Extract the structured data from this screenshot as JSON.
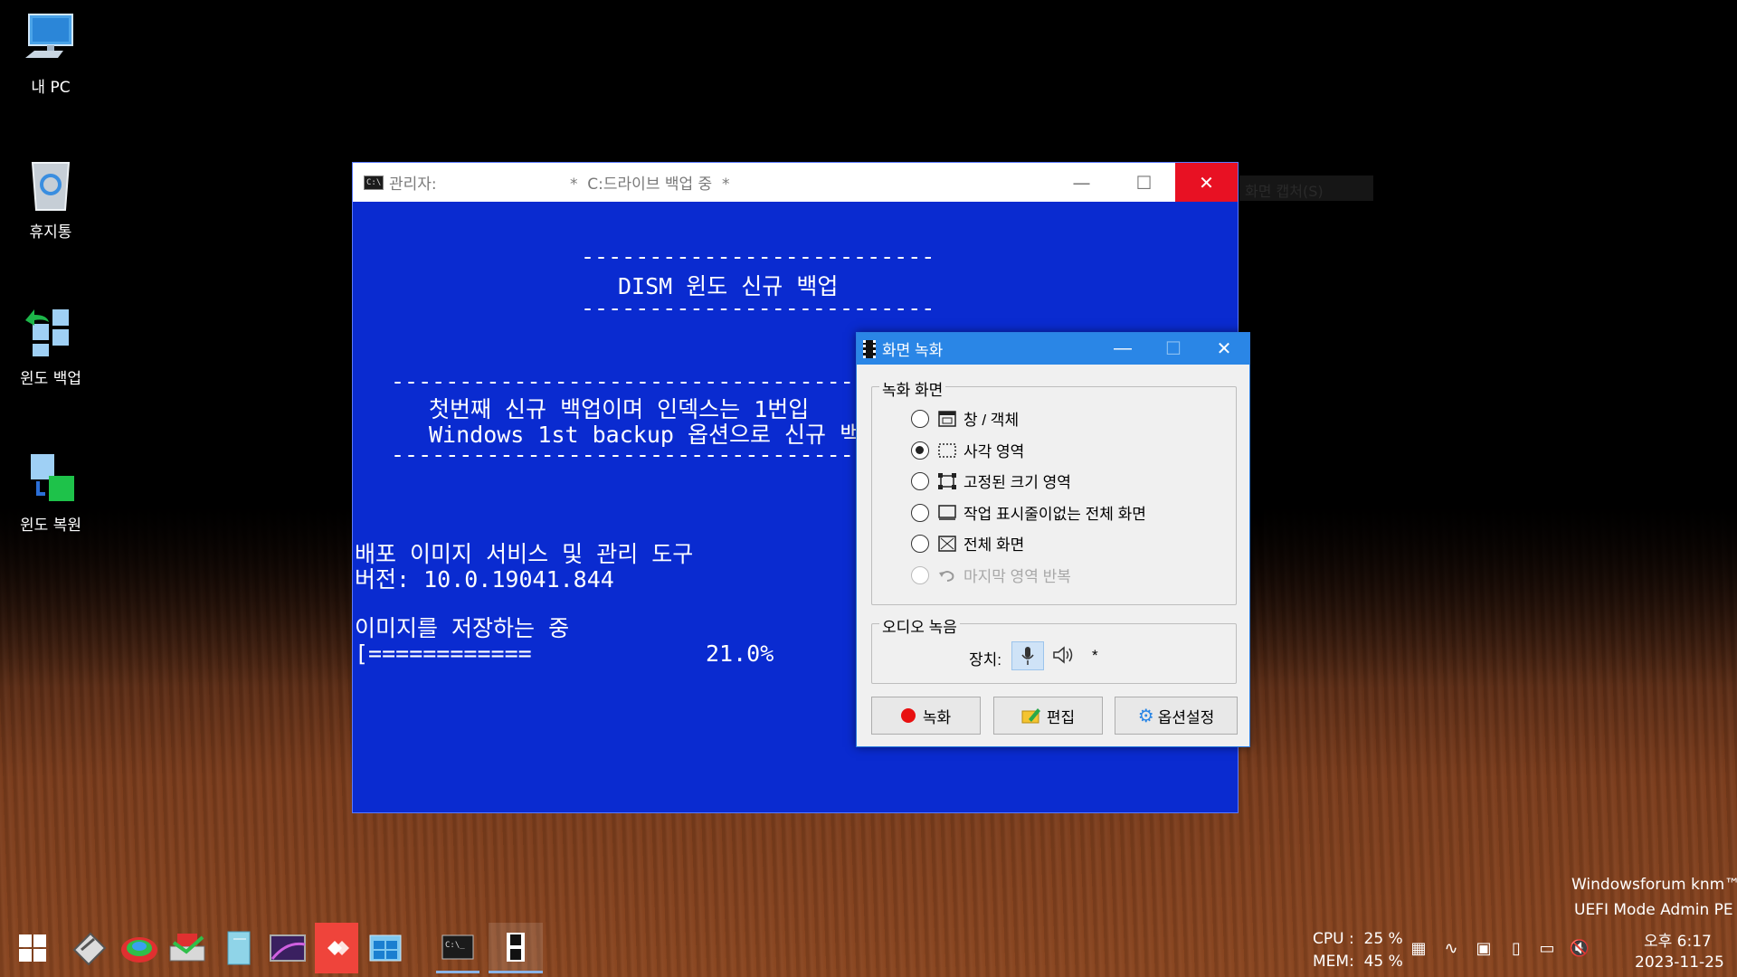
{
  "desktop": {
    "icons": [
      {
        "label": "내 PC",
        "icon": "monitor-icon"
      },
      {
        "label": "휴지통",
        "icon": "recycle-bin-icon"
      },
      {
        "label": "윈도 백업",
        "icon": "windows-backup-icon"
      },
      {
        "label": "윈도 복원",
        "icon": "windows-restore-icon"
      }
    ],
    "watermark": {
      "line1": "Windowsforum knm™",
      "line2": "UEFI Mode Admin PE"
    }
  },
  "console": {
    "title_prefix": "관리자:",
    "title_main": "*  C:드라이브 백업 중  *",
    "minimize": "—",
    "maximize": "☐",
    "close": "✕",
    "lines": {
      "rule1": "--------------------------",
      "heading": "DISM 윈도 신규 백업",
      "rule2": "--------------------------",
      "rule3": "------------------------------------------",
      "info1": "첫번째 신규 백업이며 인덱스는 1번입",
      "info2": "Windows 1st backup 옵션으로 신규 백",
      "rule4": "------------------------------------------",
      "tool_name": "배포 이미지 서비스 및 관리 도구",
      "version": "버전: 10.0.19041.844",
      "saving": "이미지를 저장하는 중",
      "progress_bar": "[============",
      "progress_pct": "21.0%"
    },
    "progress": 21.0
  },
  "capture_hint": "화면 캡처(S)",
  "recorder": {
    "title": "화면 녹화",
    "minimize": "—",
    "maximize": "☐",
    "close": "✕",
    "record_screen_group": "녹화 화면",
    "options": [
      {
        "label": "창 / 객체",
        "checked": false,
        "enabled": true,
        "icon": "window-object-icon"
      },
      {
        "label": "사각 영역",
        "checked": true,
        "enabled": true,
        "icon": "rectangle-area-icon"
      },
      {
        "label": "고정된 크기 영역",
        "checked": false,
        "enabled": true,
        "icon": "fixed-size-area-icon"
      },
      {
        "label": "작업 표시줄이없는 전체 화면",
        "checked": false,
        "enabled": true,
        "icon": "fullscreen-no-taskbar-icon"
      },
      {
        "label": "전체 화면",
        "checked": false,
        "enabled": true,
        "icon": "fullscreen-icon"
      },
      {
        "label": "마지막 영역 반복",
        "checked": false,
        "enabled": false,
        "icon": "repeat-last-area-icon"
      }
    ],
    "audio_group": "오디오 녹음",
    "device_label": "장치:",
    "device_star": "*",
    "buttons": {
      "record": "녹화",
      "edit": "편집",
      "options": "옵션설정"
    },
    "colors": {
      "titlebar": "#2a86e6",
      "record_dot": "#e81010"
    }
  },
  "taskbar": {
    "apps": [
      "start-icon",
      "disk-tool-icon",
      "partition-tool-icon",
      "backup-tool-icon",
      "notebook-icon",
      "image-viewer-icon",
      "anydesk-icon",
      "windows-setup-icon",
      "cmd-icon",
      "film-icon"
    ],
    "cpu": "CPU :  25 %",
    "mem": "MEM:  45 %",
    "time": "오후 6:17",
    "date": "2023-11-25"
  }
}
